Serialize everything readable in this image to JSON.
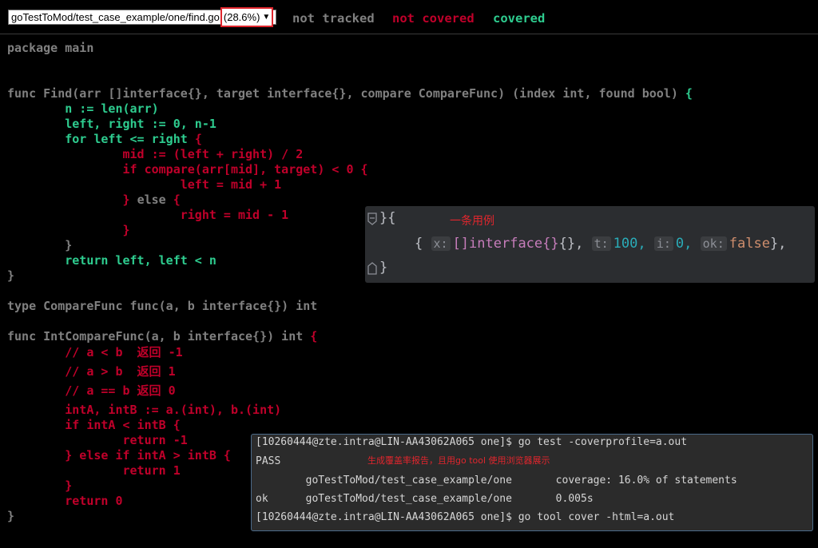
{
  "toolbar": {
    "file_name": "goTestToMod/test_case_example/one/find.go",
    "coverage_pct": "(28.6%)"
  },
  "legend": {
    "not_tracked": "not tracked",
    "not_covered": "not covered",
    "covered": "covered"
  },
  "colors": {
    "background": "#000000",
    "not_tracked": "#808080",
    "not_covered": "#c0002a",
    "covered": "#2ecc8f",
    "annotation": "#e0262d"
  },
  "code_lines": [
    [
      [
        "t",
        "package main"
      ]
    ],
    [],
    [],
    [
      [
        "t",
        "func Find(arr []interface{}, target interface{}, compare CompareFunc) (index int, found bool) "
      ],
      [
        "c",
        "{"
      ]
    ],
    [
      [
        "c",
        "        n := len(arr)"
      ]
    ],
    [
      [
        "c",
        "        left, right := 0, n-1"
      ]
    ],
    [
      [
        "c",
        "        for left <= right "
      ],
      [
        "u",
        "{"
      ]
    ],
    [
      [
        "u",
        "                mid := (left + right) / 2"
      ]
    ],
    [
      [
        "u",
        "                if compare(arr[mid], target) < 0 {"
      ]
    ],
    [
      [
        "u",
        "                        left = mid + 1"
      ]
    ],
    [
      [
        "u",
        "                } "
      ],
      [
        "t",
        "else "
      ],
      [
        "u",
        "{"
      ]
    ],
    [
      [
        "u",
        "                        right = mid - 1"
      ]
    ],
    [
      [
        "u",
        "                }"
      ]
    ],
    [
      [
        "t",
        "        }"
      ]
    ],
    [
      [
        "c",
        "        return left, left < n"
      ]
    ],
    [
      [
        "t",
        "}"
      ]
    ],
    [],
    [
      [
        "t",
        "type CompareFunc func(a, b interface{}) int"
      ]
    ],
    [],
    [
      [
        "t",
        "func IntCompareFunc(a, b interface{}) int "
      ],
      [
        "u",
        "{"
      ]
    ],
    [
      [
        "u",
        "        // a < b  返回 -1"
      ]
    ],
    [
      [
        "u",
        "        // a > b  返回 1"
      ]
    ],
    [
      [
        "u",
        "        // a == b 返回 0"
      ]
    ],
    [
      [
        "u",
        "        intA, intB := a.(int), b.(int)"
      ]
    ],
    [
      [
        "u",
        "        if intA < intB {"
      ]
    ],
    [
      [
        "u",
        "                return -1"
      ]
    ],
    [
      [
        "u",
        "        } else if intA > intB {"
      ]
    ],
    [
      [
        "u",
        "                return 1"
      ]
    ],
    [
      [
        "u",
        "        }"
      ]
    ],
    [
      [
        "u",
        "        return 0"
      ]
    ],
    [
      [
        "t",
        "}"
      ]
    ]
  ],
  "ide_panel": {
    "line1": "}{",
    "note": "一条用例",
    "open_brace": "{",
    "hint_x": "x:",
    "val_x_type": "[]interface{}",
    "val_x_rest": "{},",
    "hint_t": "t:",
    "val_t": "100,",
    "hint_i": "i:",
    "val_i": "0,",
    "hint_ok": "ok:",
    "val_ok": "false",
    "close_entry": "},",
    "line3": "}"
  },
  "terminal": {
    "lines": [
      "[10260444@zte.intra@LIN-AA43062A065 one]$ go test -coverprofile=a.out",
      "PASS",
      "        goTestToMod/test_case_example/one       coverage: 16.0% of statements",
      "ok      goTestToMod/test_case_example/one       0.005s",
      "[10260444@zte.intra@LIN-AA43062A065 one]$ go tool cover -html=a.out"
    ],
    "note": "生成覆盖率报告，且用go tool 使用浏览器展示"
  }
}
